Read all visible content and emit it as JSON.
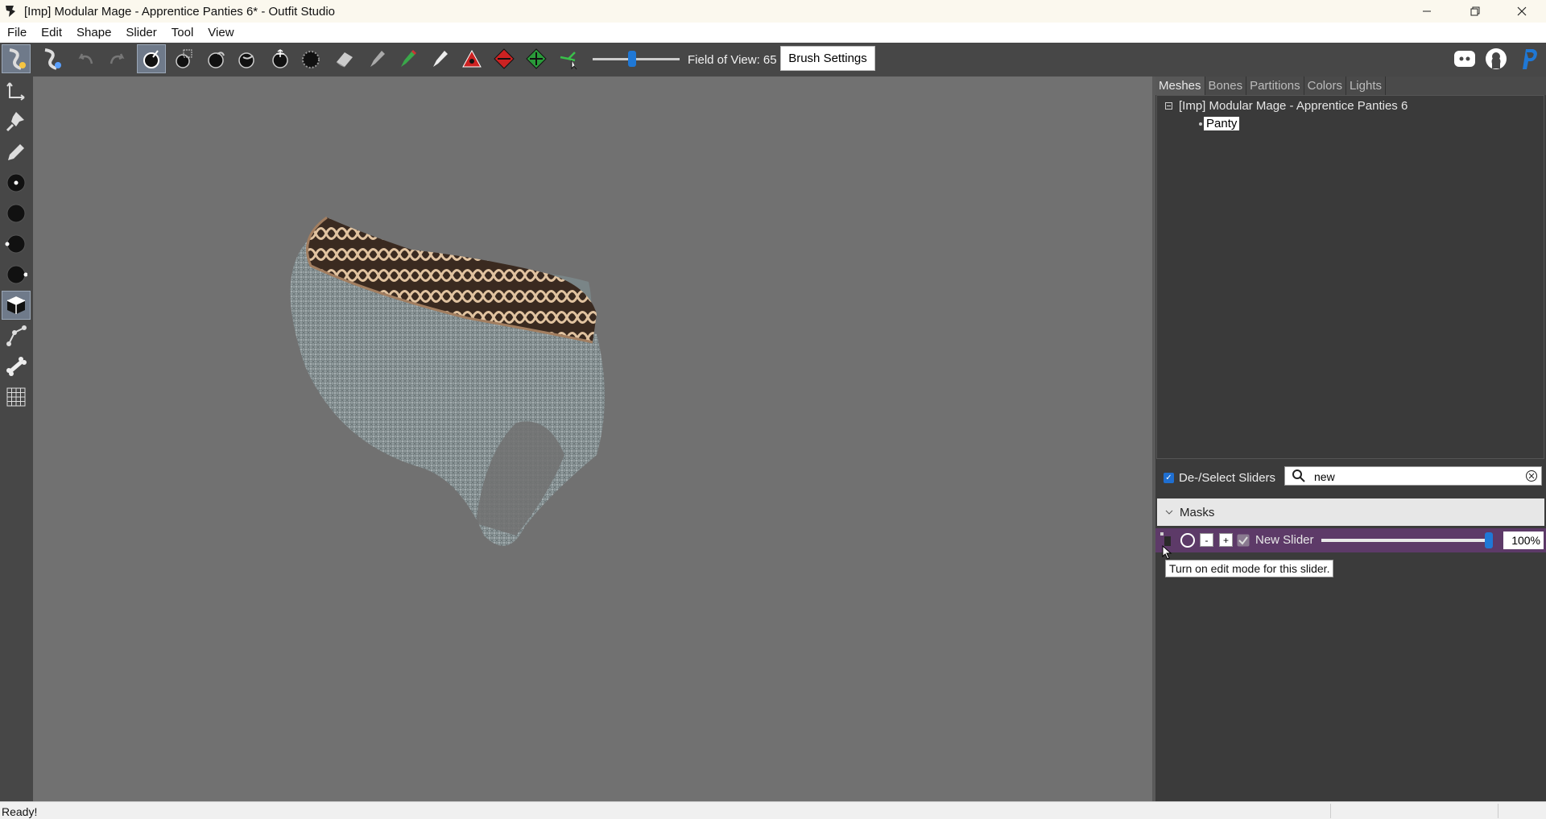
{
  "window": {
    "title": "[Imp] Modular Mage - Apprentice Panties 6* - Outfit Studio",
    "controls": [
      "minimize",
      "maximize",
      "close"
    ]
  },
  "menu": [
    "File",
    "Edit",
    "Shape",
    "Slider",
    "Tool",
    "View"
  ],
  "toolbar": {
    "icons": [
      "select-mesh-icon",
      "transform-mesh-icon",
      "undo-icon",
      "redo-icon",
      "standard-brush-icon",
      "mask-brush-icon",
      "inflate-brush-icon",
      "deflate-brush-icon",
      "move-brush-icon",
      "smooth-brush-icon",
      "undiff-brush-icon",
      "weight-brush-icon",
      "color-brush-icon",
      "alpha-brush-icon",
      "collapse-vertex-icon",
      "flip-edge-icon",
      "split-edge-icon",
      "move-vertex-icon"
    ],
    "fov_label": "Field of View: 65",
    "fov_value": 65,
    "brush_settings_label": "Brush Settings",
    "right_icons": [
      "discord-icon",
      "github-icon",
      "paypal-icon"
    ]
  },
  "left_tools": [
    "transform-tool-icon",
    "pivot-tool-icon",
    "vertex-edit-icon",
    "point-small-icon",
    "point-medium-icon",
    "point-left-icon",
    "point-right-icon",
    "cube-view-icon",
    "node-tool-icon",
    "bone-tool-icon",
    "grid-tool-icon"
  ],
  "right_panel": {
    "tabs": [
      "Meshes",
      "Bones",
      "Partitions",
      "Colors",
      "Lights"
    ],
    "active_tab": "Meshes",
    "tree": {
      "root": "[Imp] Modular Mage - Apprentice Panties 6",
      "child": "Panty"
    },
    "deselect_label": "De-/Select Sliders",
    "search_value": "new",
    "masks_label": "Masks",
    "slider": {
      "minus": "-",
      "plus": "+",
      "name": "New Slider",
      "value_label": "100%",
      "value": 1.0
    },
    "tooltip": "Turn on edit mode for this slider."
  },
  "status": "Ready!",
  "colors": {
    "viewport_bg": "#717171",
    "toolbar_bg": "#474747",
    "slider_row": "#5d3a68",
    "accent": "#1f78d6"
  }
}
